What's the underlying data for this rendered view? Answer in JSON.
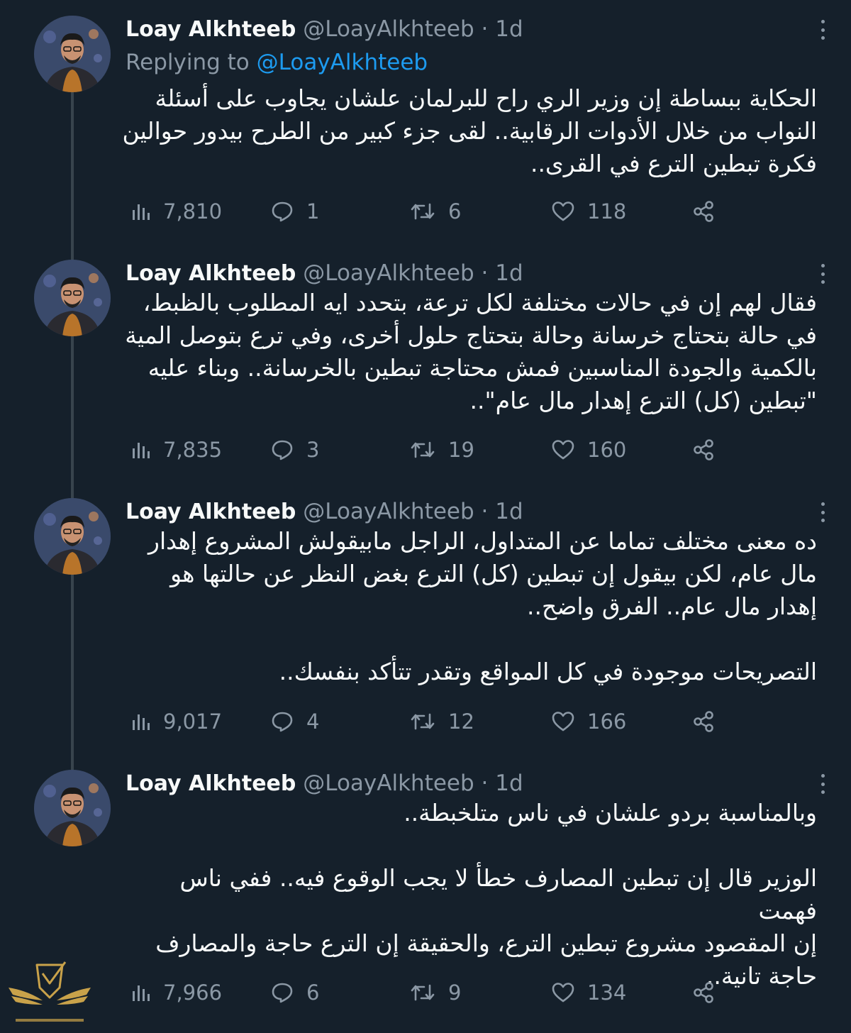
{
  "tweets": [
    {
      "name": "Loay Alkhteeb",
      "handle": "@LoayAlkhteeb",
      "dot": "·",
      "time": "1d",
      "replying_prefix": "Replying to",
      "replying_to": "@LoayAlkhteeb",
      "text": "الحكاية ببساطة إن وزير الري راح للبرلمان علشان يجاوب على أسئلة\nالنواب من خلال الأدوات الرقابية.. لقى جزء كبير من الطرح بيدور حوالين\nفكرة تبطين الترع في القرى..",
      "views": "7,810",
      "replies": "1",
      "retweets": "6",
      "likes": "118"
    },
    {
      "name": "Loay Alkhteeb",
      "handle": "@LoayAlkhteeb",
      "dot": "·",
      "time": "1d",
      "text": "فقال لهم إن في حالات مختلفة لكل ترعة، بتحدد ايه المطلوب بالظبط،\nفي حالة بتحتاج خرسانة وحالة بتحتاج حلول أخرى، وفي ترع بتوصل المية\nبالكمية والجودة المناسبين فمش محتاجة تبطين بالخرسانة..  وبناء عليه\n\"تبطين (كل) الترع إهدار مال عام\"..",
      "views": "7,835",
      "replies": "3",
      "retweets": "19",
      "likes": "160"
    },
    {
      "name": "Loay Alkhteeb",
      "handle": "@LoayAlkhteeb",
      "dot": "·",
      "time": "1d",
      "text": "ده معنى مختلف تماما عن المتداول، الراجل مابيقولش المشروع إهدار\nمال عام، لكن بيقول إن تبطين (كل) الترع بغض النظر عن حالتها هو\nإهدار مال عام.. الفرق واضح..\n\nالتصريحات موجودة في كل المواقع وتقدر تتأكد بنفسك..",
      "views": "9,017",
      "replies": "4",
      "retweets": "12",
      "likes": "166"
    },
    {
      "name": "Loay Alkhteeb",
      "handle": "@LoayAlkhteeb",
      "dot": "·",
      "time": "1d",
      "text": "وبالمناسبة بردو علشان في ناس متلخبطة..\n\nالوزير قال إن تبطين المصارف خطأ لا يجب الوقوع فيه.. ففي ناس فهمت\nإن المقصود مشروع تبطين الترع، والحقيقة إن الترع حاجة والمصارف\nحاجة تانية..",
      "views": "7,966",
      "replies": "6",
      "retweets": "9",
      "likes": "134"
    }
  ],
  "icons": {
    "views": "views-icon",
    "reply": "reply-icon",
    "retweet": "retweet-icon",
    "like": "like-icon",
    "share": "share-icon",
    "more": "more-icon"
  },
  "colors": {
    "background": "#15202b",
    "text": "#f7f9f9",
    "secondary": "#8b98a5",
    "link": "#1d9bf0",
    "thread_line": "#38444d",
    "watermark": "#c9a24a"
  }
}
